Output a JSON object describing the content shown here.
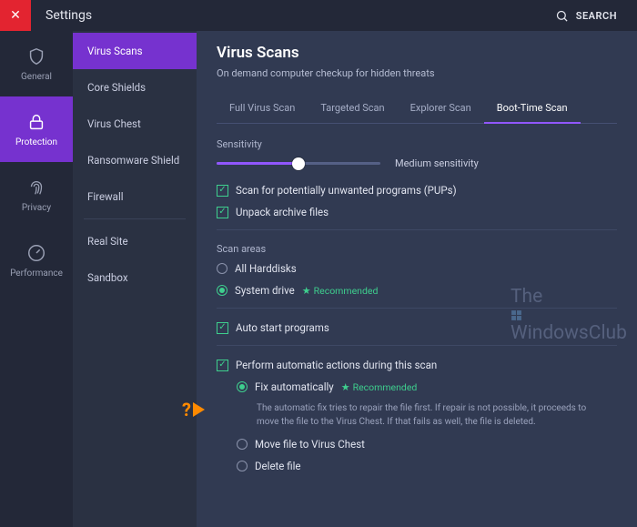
{
  "titlebar": {
    "title": "Settings",
    "search_label": "SEARCH"
  },
  "rail": [
    {
      "id": "general",
      "label": "General"
    },
    {
      "id": "protection",
      "label": "Protection",
      "active": true
    },
    {
      "id": "privacy",
      "label": "Privacy"
    },
    {
      "id": "performance",
      "label": "Performance"
    }
  ],
  "subnav": {
    "items": [
      "Virus Scans",
      "Core Shields",
      "Virus Chest",
      "Ransomware Shield",
      "Firewall",
      "Real Site",
      "Sandbox"
    ],
    "active_index": 0
  },
  "page": {
    "heading": "Virus Scans",
    "subtitle": "On demand computer checkup for hidden threats",
    "tabs": [
      "Full Virus Scan",
      "Targeted Scan",
      "Explorer Scan",
      "Boot-Time Scan"
    ],
    "active_tab": 3,
    "sensitivity": {
      "label": "Sensitivity",
      "value_label": "Medium sensitivity"
    },
    "checks": {
      "pups": {
        "label": "Scan for potentially unwanted programs (PUPs)",
        "checked": true
      },
      "arch": {
        "label": "Unpack archive files",
        "checked": true
      },
      "autos": {
        "label": "Auto start programs",
        "checked": true
      },
      "perf": {
        "label": "Perform automatic actions during this scan",
        "checked": true
      }
    },
    "scan_areas": {
      "label": "Scan areas",
      "all": {
        "label": "All Harddisks",
        "selected": false
      },
      "system": {
        "label": "System drive",
        "selected": true,
        "rec": "Recommended"
      }
    },
    "actions": {
      "fix": {
        "label": "Fix automatically",
        "selected": true,
        "rec": "Recommended",
        "desc": "The automatic fix tries to repair the file first. If repair is not possible, it proceeds to move the file to the Virus Chest. If that fails as well, the file is deleted."
      },
      "move": {
        "label": "Move file to Virus Chest",
        "selected": false
      },
      "delete": {
        "label": "Delete file",
        "selected": false
      }
    }
  },
  "watermark": {
    "line1": "The",
    "line2": "WindowsClub"
  }
}
